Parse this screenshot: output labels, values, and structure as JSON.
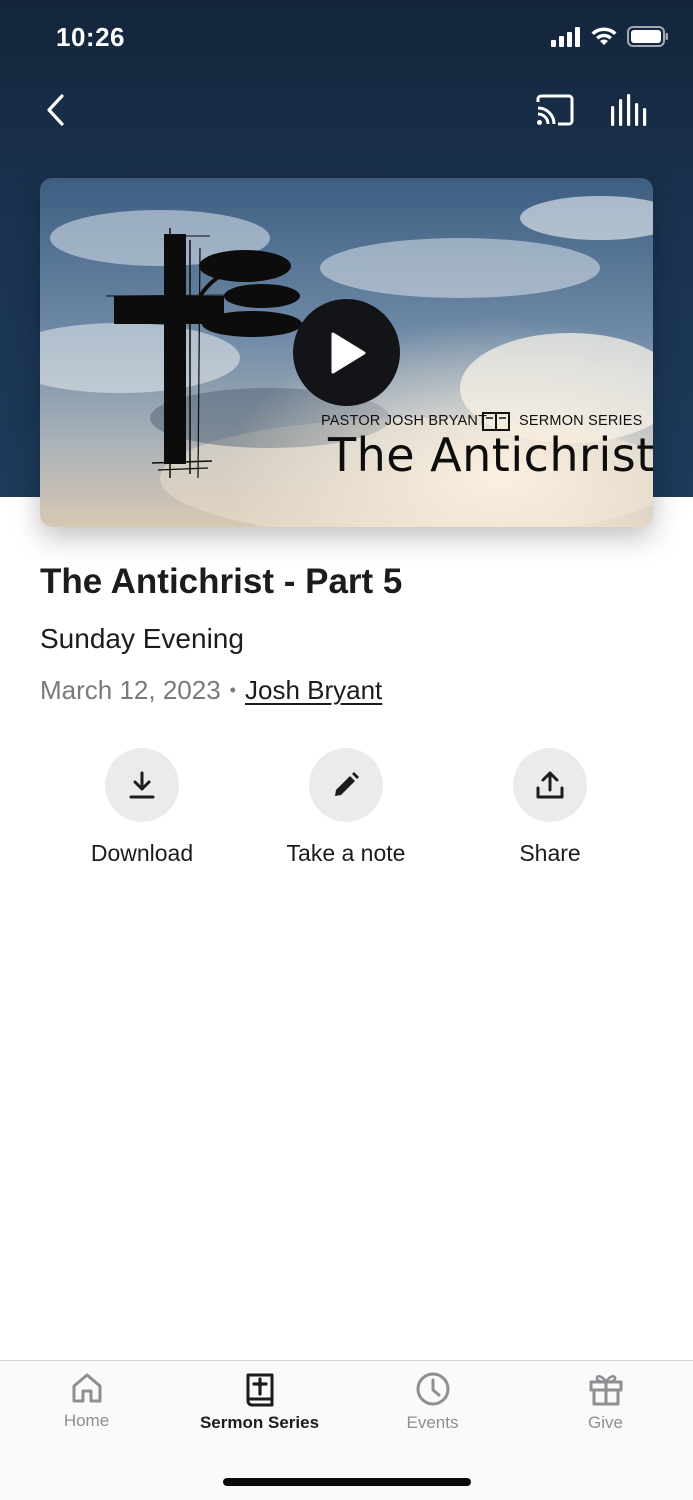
{
  "status_bar": {
    "time": "10:26",
    "icons": [
      "cellular-signal-icon",
      "wifi-icon",
      "battery-icon"
    ]
  },
  "nav": {
    "back_icon": "chevron-left-icon",
    "cast_icon": "cast-icon",
    "audio_icon": "audio-bars-icon"
  },
  "artwork": {
    "pastor_text": "PASTOR JOSH BRYANT",
    "series_text": "SERMON SERIES",
    "title_text": "The Antichrist",
    "play_icon": "play-icon"
  },
  "sermon": {
    "title": "The Antichrist - Part 5",
    "service": "Sunday Evening",
    "date": "March 12, 2023",
    "separator": "•",
    "speaker": "Josh Bryant"
  },
  "actions": [
    {
      "label": "Download",
      "icon": "download-icon"
    },
    {
      "label": "Take a note",
      "icon": "pencil-icon"
    },
    {
      "label": "Share",
      "icon": "share-icon"
    }
  ],
  "tabs": [
    {
      "label": "Home",
      "icon": "home-icon",
      "active": false
    },
    {
      "label": "Sermon Series",
      "icon": "bible-icon",
      "active": true
    },
    {
      "label": "Events",
      "icon": "clock-icon",
      "active": false
    },
    {
      "label": "Give",
      "icon": "gift-icon",
      "active": false
    }
  ],
  "colors": {
    "header_bg": "#1a3350",
    "active_tab": "#1c1c1e",
    "inactive_tab": "#8e8e93",
    "action_circle_bg": "#ebebed"
  }
}
